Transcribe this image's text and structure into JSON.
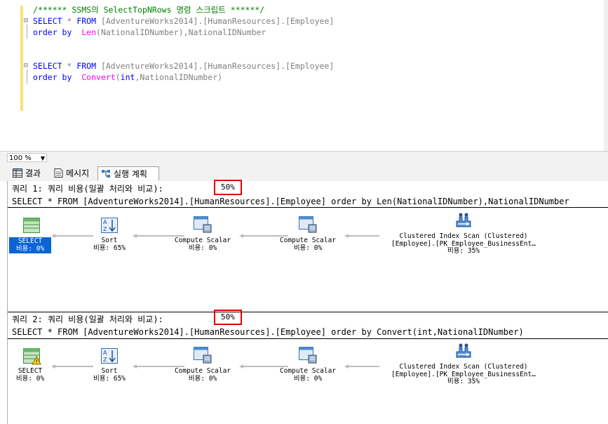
{
  "editor": {
    "lines": [
      {
        "comment": "/****** SSMS의 SelectTopNRows 명령 스크립트 ******/"
      },
      {
        "kw1": "SELECT",
        "star": " * ",
        "kw2": "FROM",
        "rest": " [AdventureWorks2014].[HumanResources].[Employee]"
      },
      {
        "kw1": "order by",
        "fn": "Len",
        "rest": "(NationalIDNumber),NationalIDNumber"
      },
      {
        "kw1": "SELECT",
        "star": " * ",
        "kw2": "FROM",
        "rest": " [AdventureWorks2014].[HumanResources].[Employee]"
      },
      {
        "kw1": "order by",
        "fn": "Convert",
        "p1": "(",
        "kw3": "int",
        "rest": ",NationalIDNumber)"
      }
    ]
  },
  "zoom": {
    "value": "100 %"
  },
  "tabs": [
    {
      "label": "결과",
      "icon": "grid-icon"
    },
    {
      "label": "메시지",
      "icon": "message-icon"
    },
    {
      "label": "실행 계획",
      "icon": "execution-plan-icon",
      "active": true
    }
  ],
  "queries": [
    {
      "header": "쿼리 1: 쿼리 비용(일괄 처리와 비교):",
      "percent": "50%",
      "sql": "SELECT * FROM [AdventureWorks2014].[HumanResources].[Employee] order by Len(NationalIDNumber),NationalIDNumber",
      "nodes": [
        {
          "label": "SELECT",
          "cost": "비용: 0%",
          "icon": "select-result-icon",
          "selected": true
        },
        {
          "label": "Sort",
          "cost": "비용: 65%",
          "icon": "sort-icon"
        },
        {
          "label": "Compute Scalar",
          "cost": "비용: 0%",
          "icon": "compute-scalar-icon"
        },
        {
          "label": "Compute Scalar",
          "cost": "비용: 0%",
          "icon": "compute-scalar-icon"
        },
        {
          "label": "Clustered Index Scan (Clustered)",
          "label2": "[Employee].[PK_Employee_BusinessEnt…",
          "cost": "비용: 35%",
          "icon": "clustered-index-scan-icon"
        }
      ]
    },
    {
      "header": "쿼리 2: 쿼리 비용(일괄 처리와 비교):",
      "percent": "50%",
      "sql": "SELECT * FROM [AdventureWorks2014].[HumanResources].[Employee] order by Convert(int,NationalIDNumber)",
      "nodes": [
        {
          "label": "SELECT",
          "cost": "비용: 0%",
          "icon": "select-warning-icon"
        },
        {
          "label": "Sort",
          "cost": "비용: 65%",
          "icon": "sort-icon"
        },
        {
          "label": "Compute Scalar",
          "cost": "비용: 0%",
          "icon": "compute-scalar-icon"
        },
        {
          "label": "Compute Scalar",
          "cost": "비용: 0%",
          "icon": "compute-scalar-icon"
        },
        {
          "label": "Clustered Index Scan (Clustered)",
          "label2": "[Employee].[PK_Employee_BusinessEnt…",
          "cost": "비용: 35%",
          "icon": "clustered-index-scan-icon"
        }
      ]
    }
  ],
  "colors": {
    "keyword": "#0000ff",
    "comment": "#008000",
    "function": "#ff00ff",
    "highlight_box": "#e00000",
    "selection": "#0a64d2"
  }
}
